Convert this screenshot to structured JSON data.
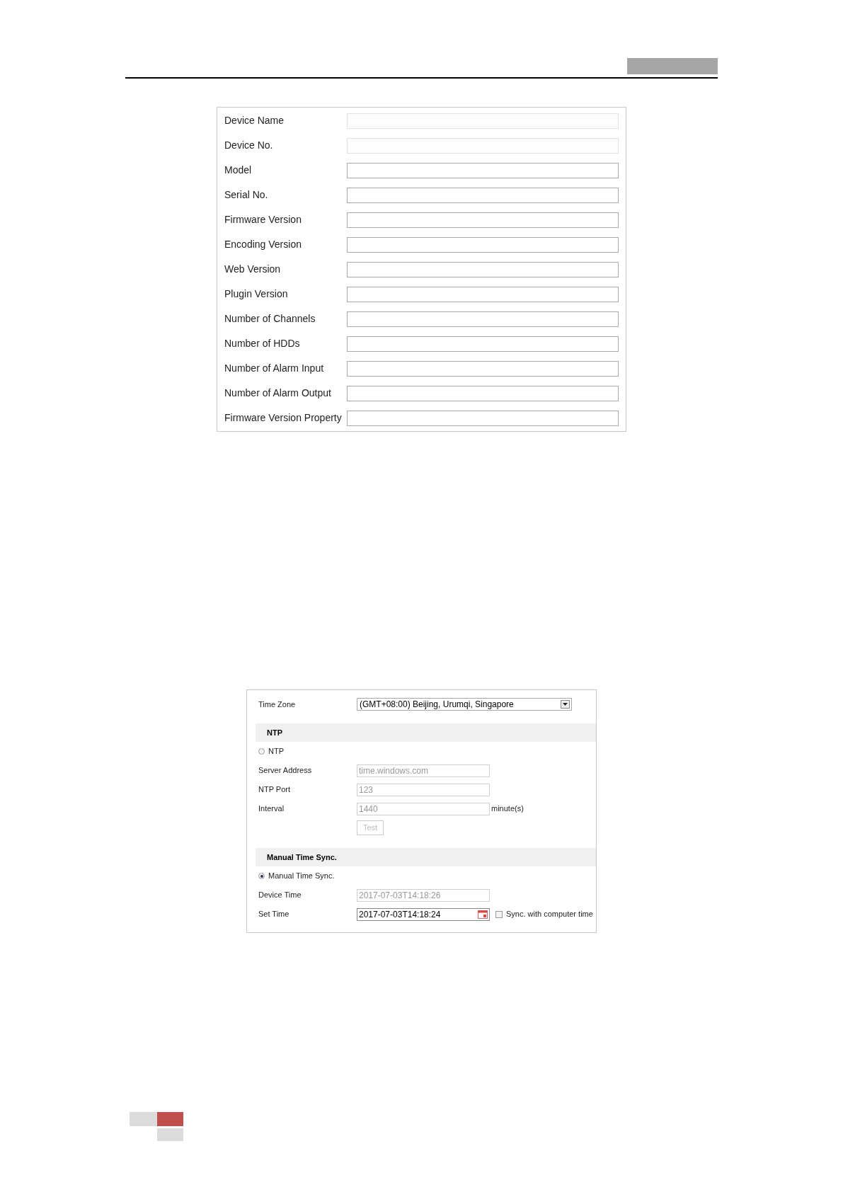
{
  "info_panel": {
    "fields": [
      {
        "label": "Device Name",
        "disabled": true
      },
      {
        "label": "Device No.",
        "disabled": true
      },
      {
        "label": "Model",
        "disabled": false
      },
      {
        "label": "Serial No.",
        "disabled": false
      },
      {
        "label": "Firmware Version",
        "disabled": false
      },
      {
        "label": "Encoding Version",
        "disabled": false
      },
      {
        "label": "Web Version",
        "disabled": false
      },
      {
        "label": "Plugin Version",
        "disabled": false
      },
      {
        "label": "Number of Channels",
        "disabled": false
      },
      {
        "label": "Number of HDDs",
        "disabled": false
      },
      {
        "label": "Number of Alarm Input",
        "disabled": false
      },
      {
        "label": "Number of Alarm Output",
        "disabled": false
      },
      {
        "label": "Firmware Version Property",
        "disabled": false
      }
    ]
  },
  "time_panel": {
    "time_zone": {
      "label": "Time Zone",
      "value": "(GMT+08:00) Beijing, Urumqi, Singapore"
    },
    "sections": [
      {
        "title": "NTP",
        "mode": {
          "label": "NTP",
          "selected": false
        },
        "rows": [
          {
            "kind": "text",
            "label": "Server Address",
            "value": "time.windows.com",
            "disabled": true
          },
          {
            "kind": "text",
            "label": "NTP Port",
            "value": "123",
            "disabled": true
          },
          {
            "kind": "text",
            "label": "Interval",
            "value": "1440",
            "unit": "minute(s)",
            "disabled": true
          },
          {
            "kind": "button",
            "label": "Test",
            "disabled": true
          }
        ]
      },
      {
        "title": "Manual Time Sync.",
        "mode": {
          "label": "Manual Time Sync.",
          "selected": true
        },
        "rows": [
          {
            "kind": "text",
            "label": "Device Time",
            "value": "2017-07-03T14:18:26",
            "disabled": true
          },
          {
            "kind": "datetime",
            "label": "Set Time",
            "value": "2017-07-03T14:18:24",
            "disabled": false,
            "checkbox": {
              "label": "Sync. with computer time",
              "checked": false
            }
          }
        ]
      }
    ]
  }
}
